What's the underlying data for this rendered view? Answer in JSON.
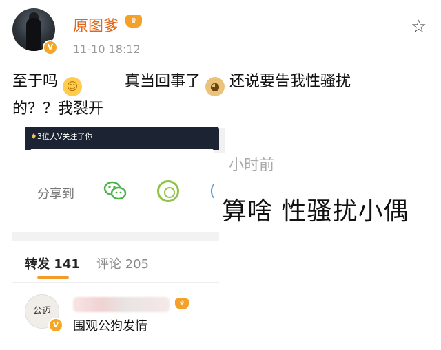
{
  "post": {
    "username": "原图爹",
    "timestamp": "11-10 18:12",
    "verified_badge": "V",
    "member_badge": "crown-icon",
    "line1_a": "至于吗",
    "line1_b": "真当回事了",
    "line1_c": "还说要告我性骚扰",
    "line2": "的？？我裂开",
    "emojis": [
      "thinking-face-emoji",
      "doge-emoji"
    ]
  },
  "embed": {
    "notification": "3位大V关注了你",
    "share_label": "分享到",
    "share_icons": [
      "wechat-icon",
      "moments-icon"
    ],
    "overlay_ago": "小时前",
    "overlay_text": "算啥 性骚扰小偶"
  },
  "tabs": {
    "repost_label": "转发",
    "repost_count": "141",
    "comment_label": "评论",
    "comment_count": "205"
  },
  "repost": {
    "avatar_text": "公迈",
    "text": "围观公狗发情"
  },
  "colors": {
    "username": "#e0661c",
    "accent": "#f39b2b",
    "badge": "#f5a623"
  }
}
